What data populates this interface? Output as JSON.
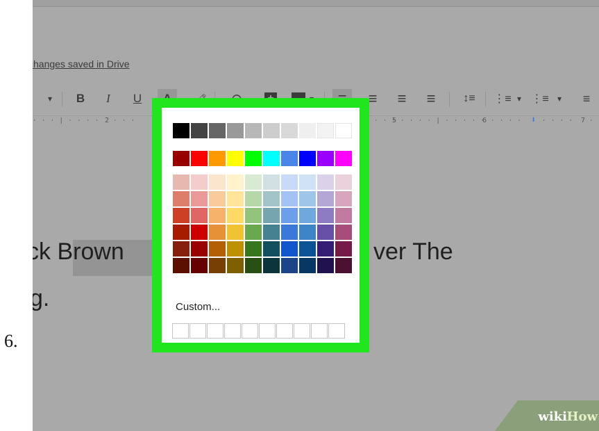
{
  "step_number": "6.",
  "doc": {
    "save_status": "changes saved in Drive",
    "line1": "ck Brown",
    "line1_right": "ver The",
    "line2": "g."
  },
  "toolbar": {
    "chevron": "▾",
    "bold": "B",
    "italic": "I",
    "underline": "U",
    "text_color": "A",
    "highlight": "🖍",
    "link": "⊖",
    "comment": "+",
    "image": "▲",
    "align_left": "≡",
    "align_center": "≡",
    "align_right": "≡",
    "justify": "≡",
    "line_spacing": "↕≡",
    "numbered_list": "⋮≡",
    "bulleted_list": "⋮≡"
  },
  "ruler": {
    "marks": [
      "2",
      "5",
      "6",
      "7"
    ]
  },
  "palette": {
    "custom_label": "Custom...",
    "grays": [
      "#000000",
      "#434343",
      "#666666",
      "#999999",
      "#b7b7b7",
      "#cccccc",
      "#d9d9d9",
      "#efefef",
      "#f3f3f3",
      "#ffffff"
    ],
    "brights": [
      "#980000",
      "#ff0000",
      "#ff9900",
      "#ffff00",
      "#00ff00",
      "#00ffff",
      "#4a86e8",
      "#0000ff",
      "#9900ff",
      "#ff00ff"
    ],
    "shades": [
      [
        "#e6b8af",
        "#f4cccc",
        "#fce5cd",
        "#fff2cc",
        "#d9ead3",
        "#d0e0e3",
        "#c9daf8",
        "#cfe2f3",
        "#d9d2e9",
        "#ead1dc"
      ],
      [
        "#dd7e6b",
        "#ea9999",
        "#f9cb9c",
        "#ffe599",
        "#b6d7a8",
        "#a2c4c9",
        "#a4c2f4",
        "#9fc5e8",
        "#b4a7d6",
        "#d5a6bd"
      ],
      [
        "#cc4125",
        "#e06666",
        "#f6b26b",
        "#ffd966",
        "#93c47d",
        "#76a5af",
        "#6d9eeb",
        "#6fa8dc",
        "#8e7cc3",
        "#c27ba0"
      ],
      [
        "#a61c00",
        "#cc0000",
        "#e69138",
        "#f1c232",
        "#6aa84f",
        "#45818e",
        "#3c78d8",
        "#3d85c6",
        "#674ea7",
        "#a64d79"
      ],
      [
        "#85200c",
        "#990000",
        "#b45f06",
        "#bf9000",
        "#38761d",
        "#134f5c",
        "#1155cc",
        "#0b5394",
        "#351c75",
        "#741b47"
      ],
      [
        "#5b0f00",
        "#660000",
        "#783f04",
        "#7f6000",
        "#274e13",
        "#0c343d",
        "#1c4587",
        "#073763",
        "#20124d",
        "#4c1130"
      ]
    ],
    "custom_slots": 10
  },
  "watermark": {
    "part1": "wiki",
    "part2": "How"
  }
}
